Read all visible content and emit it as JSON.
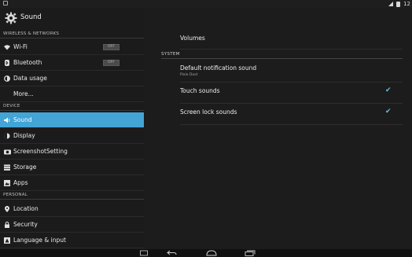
{
  "status_bar": {
    "time": "12"
  },
  "sidebar": {
    "title": "Sound",
    "sections": {
      "wireless": "WIRELESS & NETWORKS",
      "device": "DEVICE",
      "personal": "PERSONAL"
    },
    "items": [
      {
        "label": "Wi-Fi",
        "icon": "wifi-icon",
        "toggle": "OFF"
      },
      {
        "label": "Bluetooth",
        "icon": "bluetooth-icon",
        "toggle": "OFF"
      },
      {
        "label": "Data usage",
        "icon": "data-usage-icon"
      },
      {
        "label": "More...",
        "icon": ""
      },
      {
        "label": "Sound",
        "icon": "speaker-icon",
        "selected": true
      },
      {
        "label": "Display",
        "icon": "display-icon"
      },
      {
        "label": "ScreenshotSetting",
        "icon": "camera-icon"
      },
      {
        "label": "Storage",
        "icon": "storage-icon"
      },
      {
        "label": "Apps",
        "icon": "apps-icon"
      },
      {
        "label": "Location",
        "icon": "location-icon"
      },
      {
        "label": "Security",
        "icon": "lock-icon"
      },
      {
        "label": "Language & input",
        "icon": "keyboard-icon"
      }
    ]
  },
  "main": {
    "volumes": "Volumes",
    "system_label": "SYSTEM",
    "default_notification": {
      "title": "Default notification sound",
      "value": "Pixie Dust"
    },
    "touch_sounds": {
      "label": "Touch sounds",
      "checked": true
    },
    "screen_lock_sounds": {
      "label": "Screen lock sounds",
      "checked": true
    }
  },
  "colors": {
    "accent": "#43a4d6",
    "background": "#1c1c1c"
  }
}
